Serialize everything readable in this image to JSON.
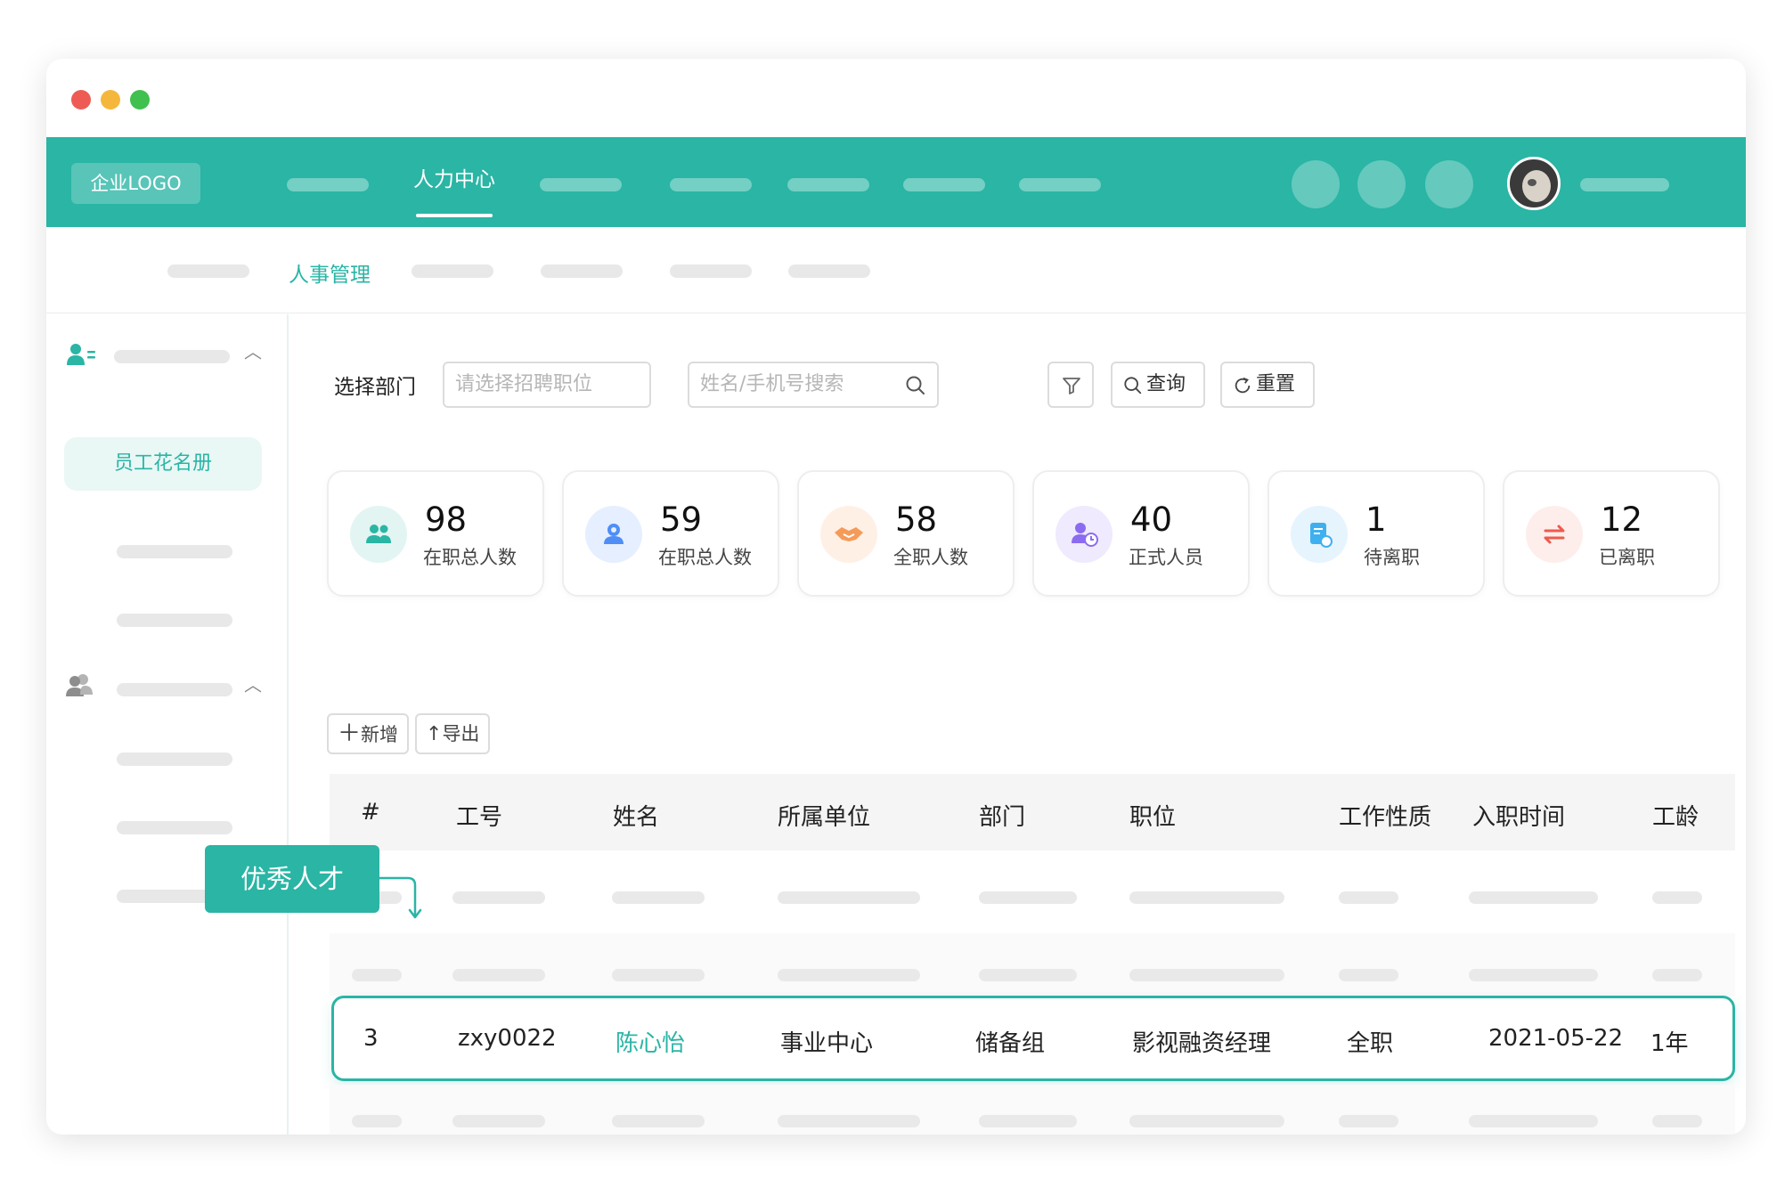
{
  "window": {
    "traffic_lights": [
      "#ee5b55",
      "#f5b73b",
      "#3fc04f"
    ]
  },
  "topnav": {
    "logo": "企业LOGO",
    "active_item": "人力中心"
  },
  "subnav": {
    "active_item": "人事管理"
  },
  "sidebar": {
    "active_item": "员工花名册"
  },
  "filters": {
    "dept_label": "选择部门",
    "position_placeholder": "请选择招聘职位",
    "search_placeholder": "姓名/手机号搜索",
    "query_label": "查询",
    "reset_label": "重置"
  },
  "stats": [
    {
      "value": "98",
      "label": "在职总人数",
      "icon": "users-icon",
      "color": "#2ab5a5"
    },
    {
      "value": "59",
      "label": "在职总人数",
      "icon": "person-badge-icon",
      "color": "#4f8ef7"
    },
    {
      "value": "58",
      "label": "全职人数",
      "icon": "handshake-icon",
      "color": "#f59b5a"
    },
    {
      "value": "40",
      "label": "正式人员",
      "icon": "person-clock-icon",
      "color": "#8b6cf0"
    },
    {
      "value": "1",
      "label": "待离职",
      "icon": "document-icon",
      "color": "#3fb0ef"
    },
    {
      "value": "12",
      "label": "已离职",
      "icon": "swap-icon",
      "color": "#ef5a4c"
    }
  ],
  "actions": {
    "add_label": "新增",
    "export_label": "导出"
  },
  "table": {
    "headers": [
      "#",
      "工号",
      "姓名",
      "所属单位",
      "部门",
      "职位",
      "工作性质",
      "入职时间",
      "工龄"
    ],
    "highlight_row": {
      "index": "3",
      "id": "zxy0022",
      "name": "陈心怡",
      "unit": "事业中心",
      "dept": "储备组",
      "position": "影视融资经理",
      "type": "全职",
      "date": "2021-05-22",
      "tenure": "1年"
    }
  },
  "callout": {
    "label": "优秀人才"
  }
}
